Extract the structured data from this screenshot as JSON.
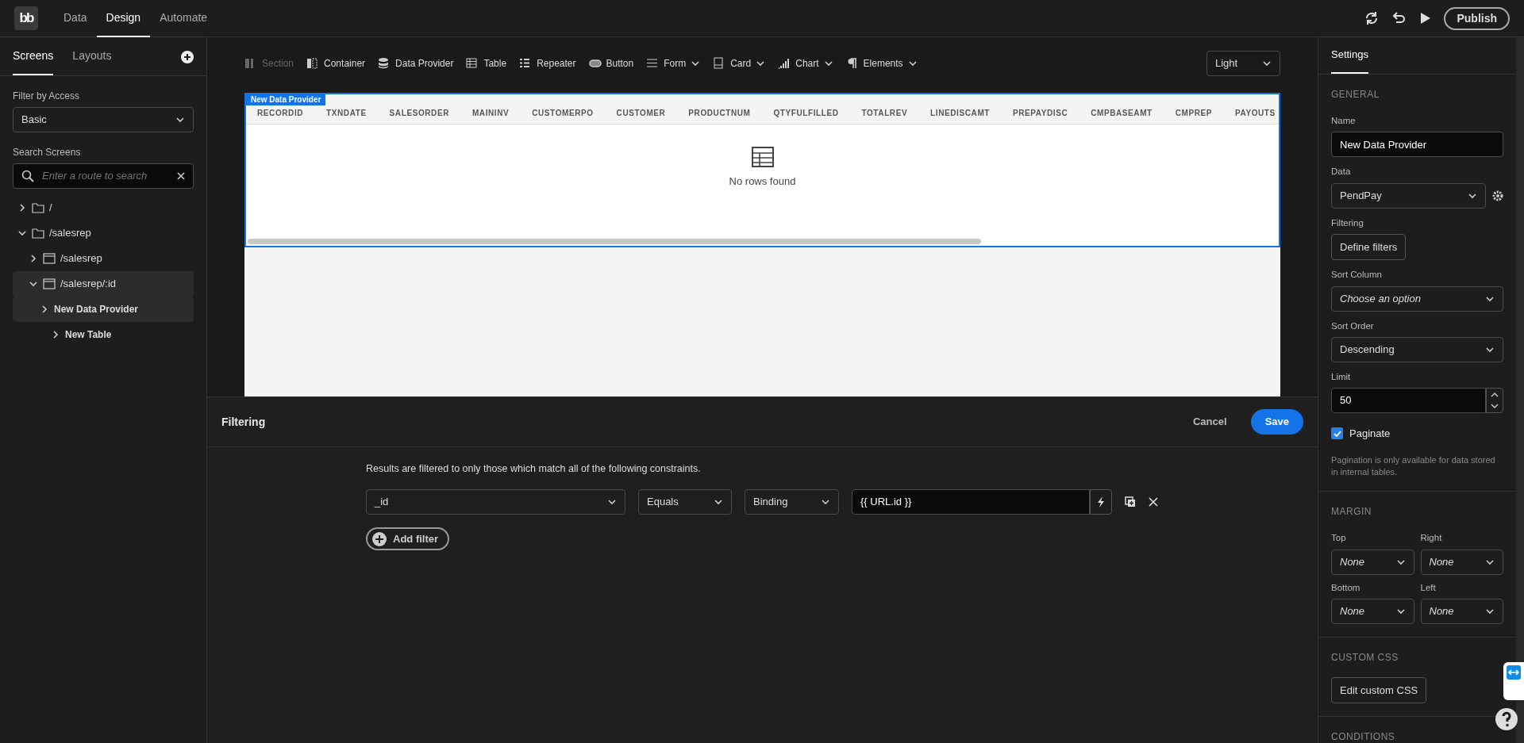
{
  "topbar": {
    "logo": "bb",
    "nav": [
      {
        "label": "Data",
        "selected": false
      },
      {
        "label": "Design",
        "selected": true
      },
      {
        "label": "Automate",
        "selected": false
      }
    ],
    "publish": "Publish"
  },
  "sidebar": {
    "tabs": [
      {
        "label": "Screens",
        "selected": true
      },
      {
        "label": "Layouts",
        "selected": false
      }
    ],
    "filter_label": "Filter by Access",
    "filter_value": "Basic",
    "search_label": "Search Screens",
    "search_placeholder": "Enter a route to search",
    "tree": [
      {
        "label": "/",
        "kind": "folder",
        "expanded": false,
        "selected": false
      },
      {
        "label": "/salesrep",
        "kind": "folder",
        "expanded": true,
        "selected": false,
        "children": [
          {
            "label": "/salesrep",
            "kind": "screen",
            "expanded": false,
            "selected": false
          },
          {
            "label": "/salesrep/:id",
            "kind": "screen",
            "expanded": true,
            "selected": true,
            "children": [
              {
                "label": "New Data Provider",
                "kind": "component",
                "expanded": false,
                "selected": true,
                "children": [
                  {
                    "label": "New Table",
                    "kind": "component",
                    "expanded": false,
                    "selected": false
                  }
                ]
              }
            ]
          }
        ]
      }
    ]
  },
  "toolbar": {
    "items": [
      {
        "label": "Section",
        "kind": "section",
        "dropdown": false,
        "disabled": true
      },
      {
        "label": "Container",
        "kind": "container",
        "dropdown": false,
        "disabled": false
      },
      {
        "label": "Data Provider",
        "kind": "database",
        "dropdown": false,
        "disabled": false
      },
      {
        "label": "Table",
        "kind": "table",
        "dropdown": false,
        "disabled": false
      },
      {
        "label": "Repeater",
        "kind": "list",
        "dropdown": false,
        "disabled": false
      },
      {
        "label": "Button",
        "kind": "button",
        "dropdown": false,
        "disabled": false
      },
      {
        "label": "Form",
        "kind": "form",
        "dropdown": true,
        "disabled": false
      },
      {
        "label": "Card",
        "kind": "card",
        "dropdown": true,
        "disabled": false
      },
      {
        "label": "Chart",
        "kind": "chart",
        "dropdown": true,
        "disabled": false
      },
      {
        "label": "Elements",
        "kind": "paragraph",
        "dropdown": true,
        "disabled": false
      }
    ],
    "theme": "Light"
  },
  "preview": {
    "badge": "New Data Provider",
    "columns": [
      "RECORDID",
      "TXNDATE",
      "SALESORDER",
      "MAININV",
      "CUSTOMERPO",
      "CUSTOMER",
      "PRODUCTNUM",
      "QTYFULFILLED",
      "TOTALREV",
      "LINEDISCAMT",
      "PREPAYDISC",
      "CMPBASEAMT",
      "CMPREP",
      "PAYOUTS"
    ],
    "empty": "No rows found"
  },
  "modal": {
    "title": "Filtering",
    "cancel": "Cancel",
    "save": "Save",
    "description": "Results are filtered to only those which match all of the following constraints.",
    "filters": [
      {
        "field": "_id",
        "operator": "Equals",
        "type": "Binding",
        "value": "{{ URL.id }}"
      }
    ],
    "add": "Add filter"
  },
  "settings": {
    "tab": "Settings",
    "general": "GENERAL",
    "name_label": "Name",
    "name_value": "New Data Provider",
    "data_label": "Data",
    "data_value": "PendPay",
    "filtering_label": "Filtering",
    "filtering_button": "Define filters",
    "sort_column_label": "Sort Column",
    "sort_column_placeholder": "Choose an option",
    "sort_order_label": "Sort Order",
    "sort_order_value": "Descending",
    "limit_label": "Limit",
    "limit_value": "50",
    "paginate_label": "Paginate",
    "paginate_checked": true,
    "paginate_note": "Pagination is only available for data stored in internal tables.",
    "margin": "MARGIN",
    "margins": [
      {
        "label": "Top",
        "value": "None"
      },
      {
        "label": "Right",
        "value": "None"
      },
      {
        "label": "Bottom",
        "value": "None"
      },
      {
        "label": "Left",
        "value": "None"
      }
    ],
    "custom_css": "CUSTOM CSS",
    "custom_css_button": "Edit custom CSS",
    "conditions": "CONDITIONS"
  }
}
